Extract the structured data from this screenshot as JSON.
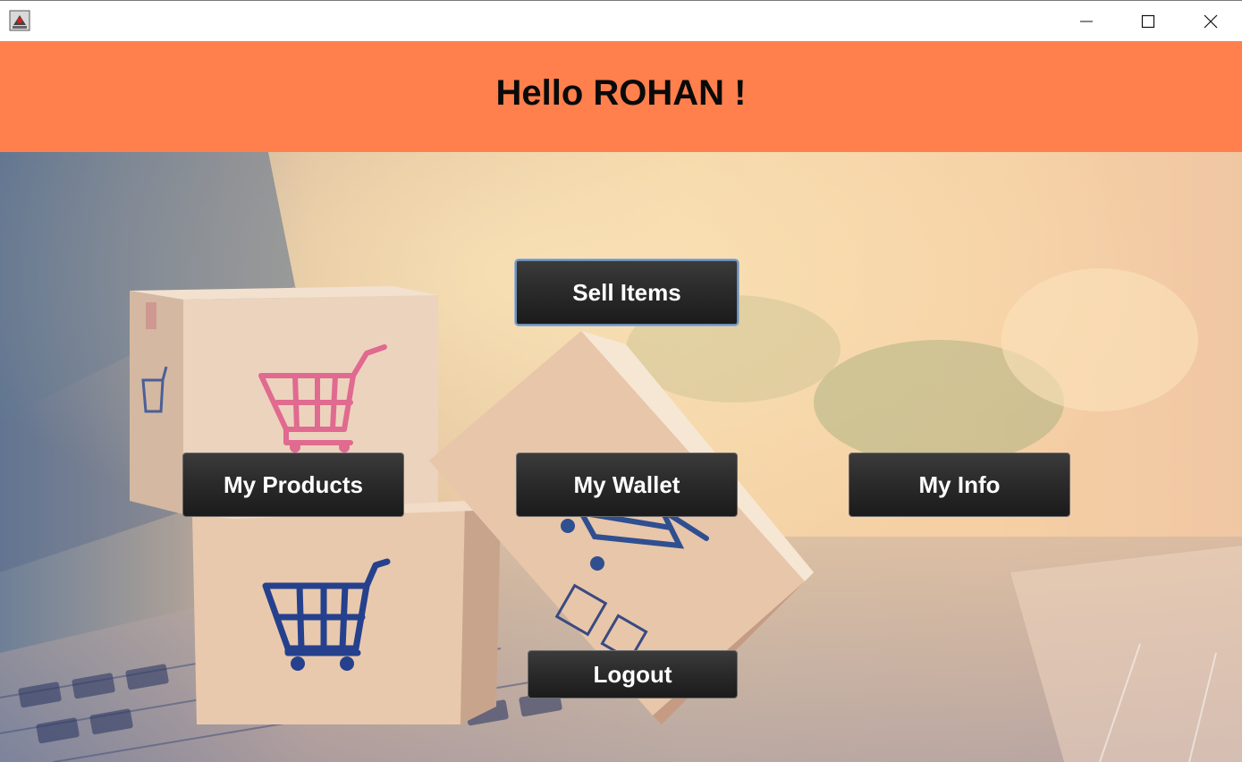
{
  "window": {
    "app_icon": "java-duke-icon",
    "controls": [
      "minimize-icon",
      "maximize-icon",
      "close-icon"
    ]
  },
  "header": {
    "greeting": "Hello ROHAN !",
    "background_color": "#ff7f4d"
  },
  "actions": {
    "sell_items": "Sell Items",
    "my_products": "My Products",
    "my_wallet": "My Wallet",
    "my_info": "My Info",
    "logout": "Logout"
  },
  "background": {
    "image": "shopping-cart-boxes-on-laptop"
  }
}
